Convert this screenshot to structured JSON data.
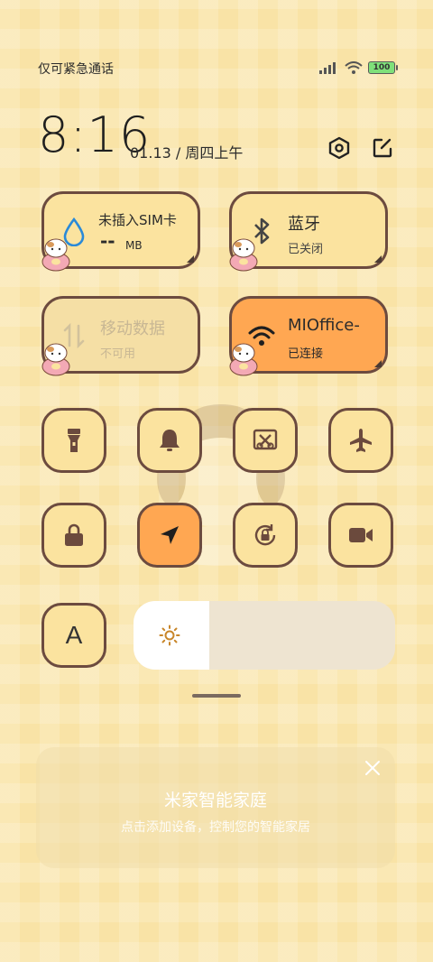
{
  "status_bar": {
    "carrier": "仅可紧急通话",
    "battery_level": "100"
  },
  "header": {
    "time": "8:16",
    "date": "01.13 / 周四上午"
  },
  "tiles": [
    {
      "title": "未插入SIM卡",
      "value": "--",
      "unit": "MB",
      "state": "normal"
    },
    {
      "title": "蓝牙",
      "subtitle": "已关闭",
      "state": "normal"
    },
    {
      "title": "移动数据",
      "subtitle": "不可用",
      "state": "disabled"
    },
    {
      "title": "MIOffice-",
      "subtitle": "已连接",
      "state": "active"
    }
  ],
  "toggles": [
    {
      "icon": "flashlight-icon",
      "on": false
    },
    {
      "icon": "bell-icon",
      "on": false
    },
    {
      "icon": "screenshot-icon",
      "on": false
    },
    {
      "icon": "airplane-icon",
      "on": false
    },
    {
      "icon": "lock-icon",
      "on": false
    },
    {
      "icon": "location-icon",
      "on": true
    },
    {
      "icon": "rotation-lock-icon",
      "on": false
    },
    {
      "icon": "video-camera-icon",
      "on": false
    }
  ],
  "auto_brightness_label": "A",
  "brightness": {
    "level": 0.29
  },
  "smart_home": {
    "title": "米家智能家庭",
    "subtitle": "点击添加设备，控制您的智能家居"
  },
  "colors": {
    "background": "#f9e3a6",
    "tile": "#fbe39f",
    "active": "#ffa752",
    "border": "#6c4b3f"
  }
}
